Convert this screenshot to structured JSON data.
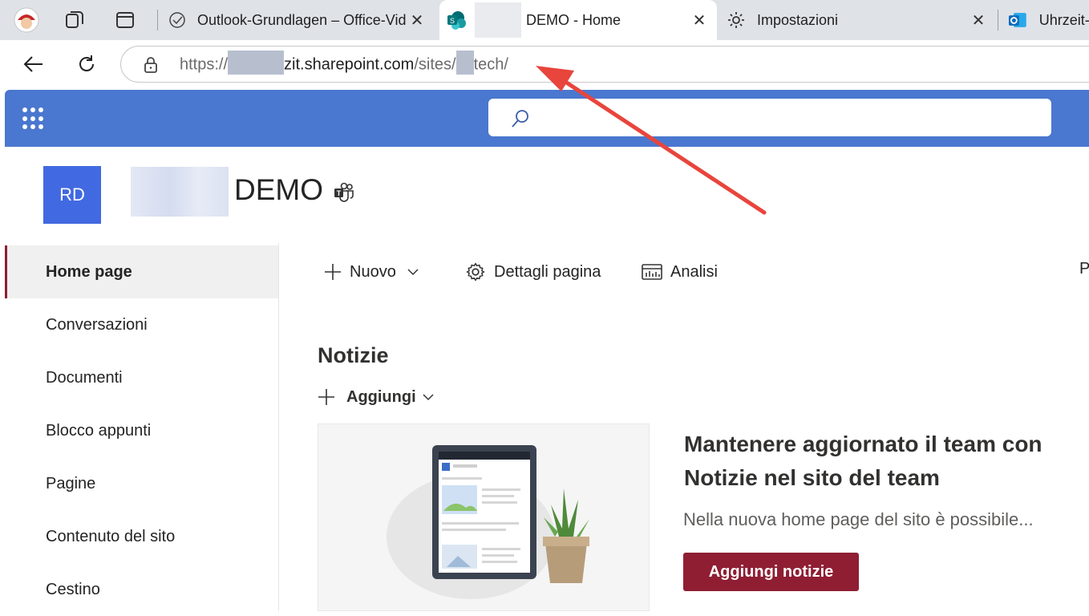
{
  "browser": {
    "tabs": [
      {
        "title": "Outlook-Grundlagen – Office-Vid"
      },
      {
        "title": "DEMO - Home"
      },
      {
        "title": "Impostazioni"
      },
      {
        "title": "Uhrzeit-"
      }
    ],
    "close_glyph": "✕",
    "address": {
      "scheme": "https://",
      "host": "zit.sharepoint.com",
      "path_a": "/sites/",
      "path_b": "tech/"
    }
  },
  "site": {
    "avatar_initials": "RD",
    "title": "DEMO",
    "accent_color": "#8f1e33",
    "suite_color": "#4a77cf"
  },
  "leftnav": {
    "items": [
      {
        "label": "Home page"
      },
      {
        "label": "Conversazioni"
      },
      {
        "label": "Documenti"
      },
      {
        "label": "Blocco appunti"
      },
      {
        "label": "Pagine"
      },
      {
        "label": "Contenuto del sito"
      },
      {
        "label": "Cestino"
      }
    ]
  },
  "commandbar": {
    "new_label": "Nuovo",
    "details_label": "Dettagli pagina",
    "analytics_label": "Analisi",
    "cut_label": "P"
  },
  "news": {
    "title": "Notizie",
    "add_label": "Aggiungi",
    "headline": "Mantenere aggiornato il team con Notizie nel sito del team",
    "description": "Nella nuova home page del sito è possibile...",
    "button_label": "Aggiungi notizie"
  }
}
